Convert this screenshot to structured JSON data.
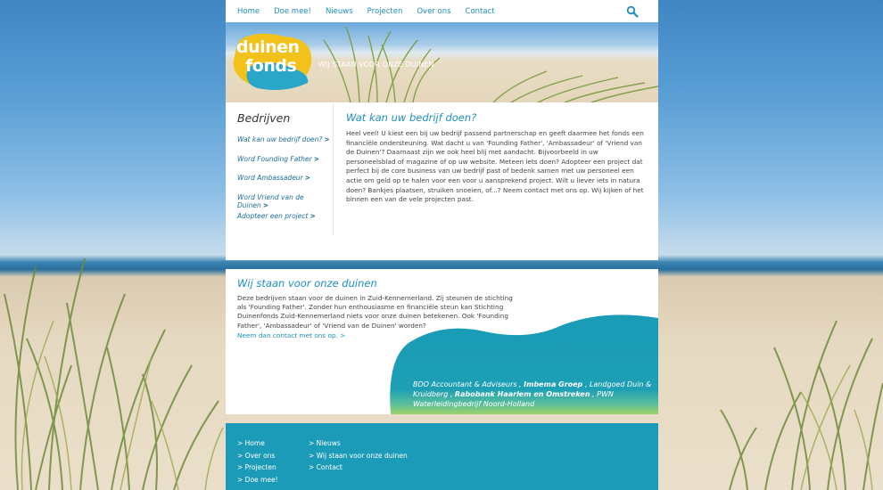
{
  "topnav": {
    "items": [
      "Home",
      "Doe mee!",
      "Nieuws",
      "Projecten",
      "Over ons",
      "Contact"
    ]
  },
  "hero": {
    "logo_line1": "duinen",
    "logo_line2": "fonds",
    "tagline": "WIJ STAAN VOOR ONZE DUINEN"
  },
  "sidebar": {
    "title": "Bedrijven",
    "items": [
      "Wat kan uw bedrijf doen?",
      "Word Founding Father",
      "Word Ambassadeur",
      "Word Vriend van de Duinen",
      "Adopteer een project"
    ],
    "arrow": ">"
  },
  "content": {
    "title": "Wat kan uw bedrijf doen?",
    "body": "Heel veel! U kiest een bij uw bedrijf passend partnerschap en geeft daarmee het fonds een financiële ondersteuning. Wat dacht u van 'Founding Father', 'Ambassadeur' of 'Vriend van de Duinen'? Daarnaast zijn we ook heel blij met aandacht. Bijvoorbeeld in uw personeelsblad of magazine of op uw website. Meteen iets doen? Adopteer een project dat perfect bij de core business van uw bedrijf past of bedenk samen met uw personeel een actie om geld op te halen voor een voor u aansprekend project. Wilt u liever iets in natura doen? Bankjes plaatsen, struiken snoeien, of...? Neem contact met ons op. Wij kijken of het binnen een van de vele projecten past."
  },
  "mid": {
    "title": "Wij staan voor onze duinen",
    "body": "Deze bedrijven staan voor de duinen in Zuid-Kennemerland. Zij steunen de stichting als 'Founding Father'. Zonder hun enthousiasme en financiële steun kan Stichting Duinenfonds Zuid-Kennemerland niets voor onze duinen betekenen. Ook 'Founding Father', 'Ambassadeur' of 'Vriend van de Duinen' worden?",
    "contact_link": "Neem dan contact met ons op. >",
    "sponsors": [
      {
        "name": "BDO Accountant & Adviseurs",
        "bold": false
      },
      {
        "name": "Imbema Groep",
        "bold": true
      },
      {
        "name": "Landgoed Duin & Kruidberg",
        "bold": false
      },
      {
        "name": "Rabobank Haarlem en Omstreken",
        "bold": true
      },
      {
        "name": "PWN Waterleidingbedrijf Noord-Holland",
        "bold": false
      }
    ]
  },
  "footer": {
    "col1": [
      "> Home",
      "> Over ons",
      "> Projecten",
      "> Doe mee!"
    ],
    "col2": [
      "> Nieuws",
      "> Wij staan voor onze duinen",
      "> Contact"
    ]
  },
  "colors": {
    "accent": "#1f8fc0",
    "footer": "#1b9bb8",
    "wave": "#1a9bb6"
  }
}
